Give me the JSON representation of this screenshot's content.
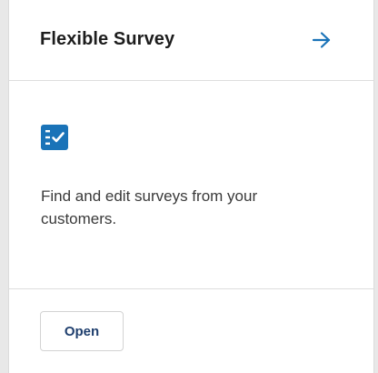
{
  "card": {
    "title": "Flexible Survey",
    "arrow_icon": "arrow-right-icon",
    "feature_icon": "survey-checklist-icon",
    "description": "Find and edit surveys from your customers.",
    "open_label": "Open"
  },
  "colors": {
    "accent": "#1a73b8",
    "title": "#1d1d1d",
    "text": "#3a3a3a",
    "button_text": "#1f3f6e",
    "background": "#e8e8e8",
    "card": "#ffffff"
  }
}
